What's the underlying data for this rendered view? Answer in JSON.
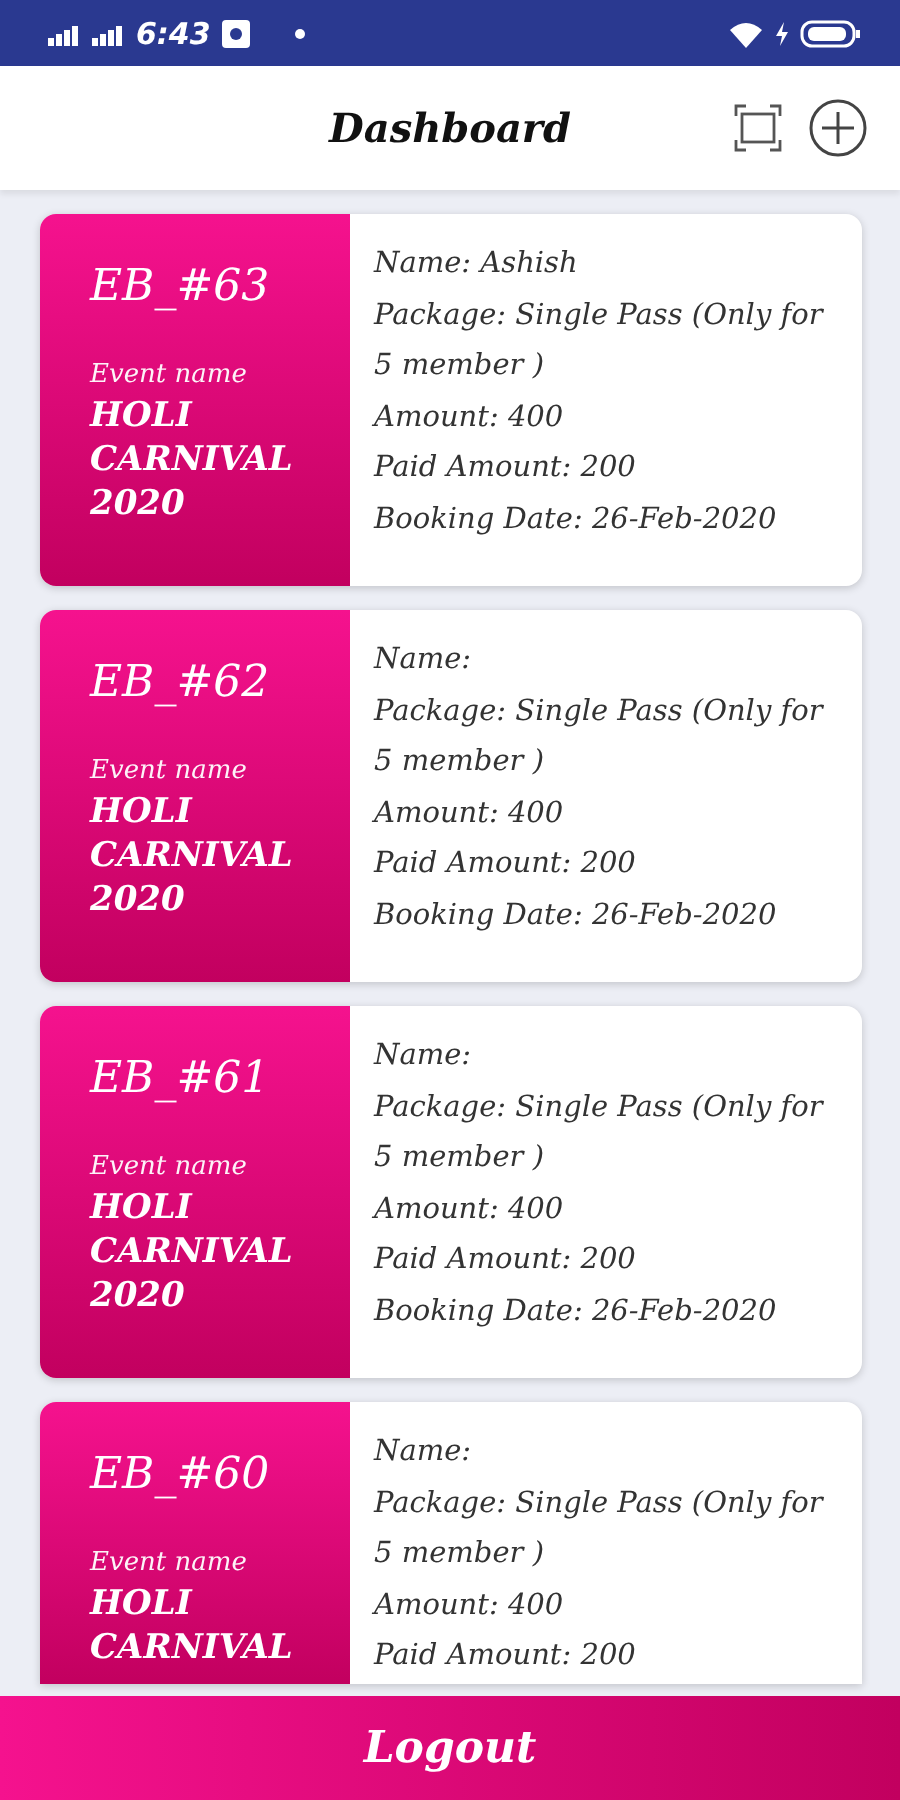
{
  "status_bar": {
    "time": "6:43"
  },
  "header": {
    "title": "Dashboard"
  },
  "bookings": [
    {
      "id": "EB_#63",
      "event_label": "Event name",
      "event_name": "HOLI CARNIVAL 2020",
      "details": [
        "Name: Ashish",
        "Package: Single Pass (Only for 5 member )",
        "Amount: 400",
        "Paid Amount: 200",
        "Booking Date: 26-Feb-2020"
      ]
    },
    {
      "id": "EB_#62",
      "event_label": "Event name",
      "event_name": "HOLI CARNIVAL 2020",
      "details": [
        "Name:",
        "Package: Single Pass (Only for 5 member )",
        "Amount: 400",
        "Paid Amount: 200",
        "Booking Date: 26-Feb-2020"
      ]
    },
    {
      "id": "EB_#61",
      "event_label": "Event name",
      "event_name": "HOLI CARNIVAL 2020",
      "details": [
        "Name:",
        "Package: Single Pass (Only for 5 member )",
        "Amount: 400",
        "Paid Amount: 200",
        "Booking Date: 26-Feb-2020"
      ]
    },
    {
      "id": "EB_#60",
      "event_label": "Event name",
      "event_name": "HOLI CARNIVAL",
      "details": [
        "Name:",
        "Package: Single Pass (Only for 5 member )",
        "Amount: 400",
        "Paid Amount: 200"
      ]
    }
  ],
  "footer": {
    "button": "Logout"
  }
}
